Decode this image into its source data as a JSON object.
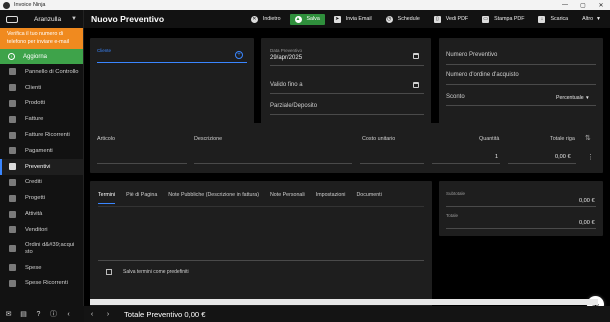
{
  "window": {
    "title": "Invoice Ninja",
    "min": "—",
    "max": "▢",
    "close": "✕"
  },
  "sidebar": {
    "company": "Aranzulla",
    "alert": "Verifica il tuo numero di telefono per inviare e-mail",
    "update": "Aggiorna",
    "items": [
      {
        "label": "Pannello di Controllo"
      },
      {
        "label": "Clienti"
      },
      {
        "label": "Prodotti"
      },
      {
        "label": "Fatture"
      },
      {
        "label": "Fatture Ricorrenti"
      },
      {
        "label": "Pagamenti"
      },
      {
        "label": "Preventivi"
      },
      {
        "label": "Crediti"
      },
      {
        "label": "Progetti"
      },
      {
        "label": "Attività"
      },
      {
        "label": "Venditori"
      },
      {
        "label": "Ordini d&#39;acquisto"
      },
      {
        "label": "Spese"
      },
      {
        "label": "Spese Ricorrenti"
      }
    ]
  },
  "header": {
    "title": "Nuovo Preventivo",
    "actions": {
      "back": "Indietro",
      "save": "Salva",
      "send": "Invia Email",
      "schedule": "Schedule",
      "pdf": "Vedi PDF",
      "print": "Stampa PDF",
      "download": "Scarica",
      "more": "Altro"
    }
  },
  "client": {
    "label": "Cliente"
  },
  "dates": {
    "date_label": "Data Preventivo",
    "date_value": "29/apr/2025",
    "valid_until": "Valido fino a",
    "partial": "Parziale/Deposito"
  },
  "numbers": {
    "quote_number": "Numero Preventivo",
    "po_number": "Numero d'ordine d'acquisto",
    "discount": "Sconto",
    "discount_type": "Percentuale"
  },
  "items": {
    "headers": {
      "item": "Articolo",
      "description": "Descrizione",
      "unit_cost": "Costo unitario",
      "quantity": "Quantità",
      "line_total": "Totale riga"
    },
    "row": {
      "quantity": "1",
      "line_total": "0,00 €"
    }
  },
  "tabs": [
    "Termini",
    "Piè di Pagina",
    "Note Pubbliche (Descrizione in fattura)",
    "Note Personali",
    "Impostazioni",
    "Documenti"
  ],
  "terms": {
    "default_label": "Salva termini come predefiniti"
  },
  "totals": {
    "subtotal_label": "Subtotale",
    "subtotal_value": "0,00 €",
    "total_label": "Totale",
    "total_value": "0,00 €"
  },
  "footer": {
    "total_text": "Totale Preventivo 0,00 €",
    "prev": "‹",
    "next": "›"
  },
  "fab": "+",
  "colors": {
    "accent": "#3a86ff",
    "save": "#2f8f3c",
    "alert": "#f08a1f",
    "update": "#3ea34a"
  }
}
